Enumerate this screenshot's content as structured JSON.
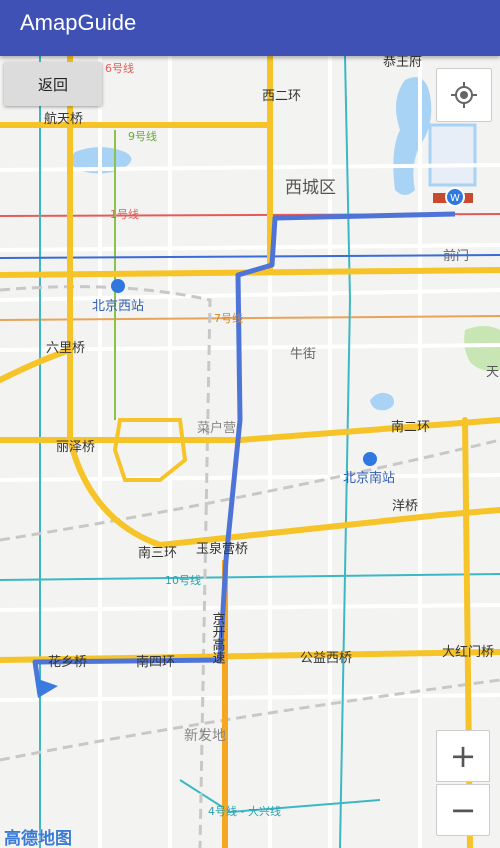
{
  "app": {
    "title": "AmapGuide"
  },
  "controls": {
    "back_label": "返回",
    "zoom_in": "+",
    "zoom_out": "−",
    "logo": "高德地图"
  },
  "labels": {
    "gongwangfu": "恭王府",
    "xizhimen_line6": "6号线",
    "xierhuan": "西二环",
    "hangtianqiao": "航天桥",
    "line9": "9号线",
    "xichengqu": "西城区",
    "line1": "1号线",
    "qianmen": "前门",
    "beijingxizhan": "北京西站",
    "line7": "7号线",
    "liuliqiao": "六里桥",
    "niujie": "牛街",
    "tian": "天",
    "caihuying": "菜户营",
    "lizeqiao": "丽泽桥",
    "naner_huan": "南二环",
    "beijingnanzhan": "北京南站",
    "yangqiao": "洋桥",
    "nansanhuan": "南三环",
    "yuquanyingqiao": "玉泉营桥",
    "line10": "10号线",
    "jingkaigaosu": "京开高速",
    "huaxiangqiao": "花乡桥",
    "nansihuan": "南四环",
    "gongyixiqiao": "公益西桥",
    "dahongmenqiao": "大红门桥",
    "xinfadi": "新发地",
    "line4": "4号线 - 大兴线"
  },
  "colors": {
    "appbar": "#3f51b5",
    "route": "#4f74d8",
    "highway": "#f6c428",
    "expressway": "#f5a623",
    "water": "#a9d3f5",
    "park": "#c8e6b4"
  }
}
